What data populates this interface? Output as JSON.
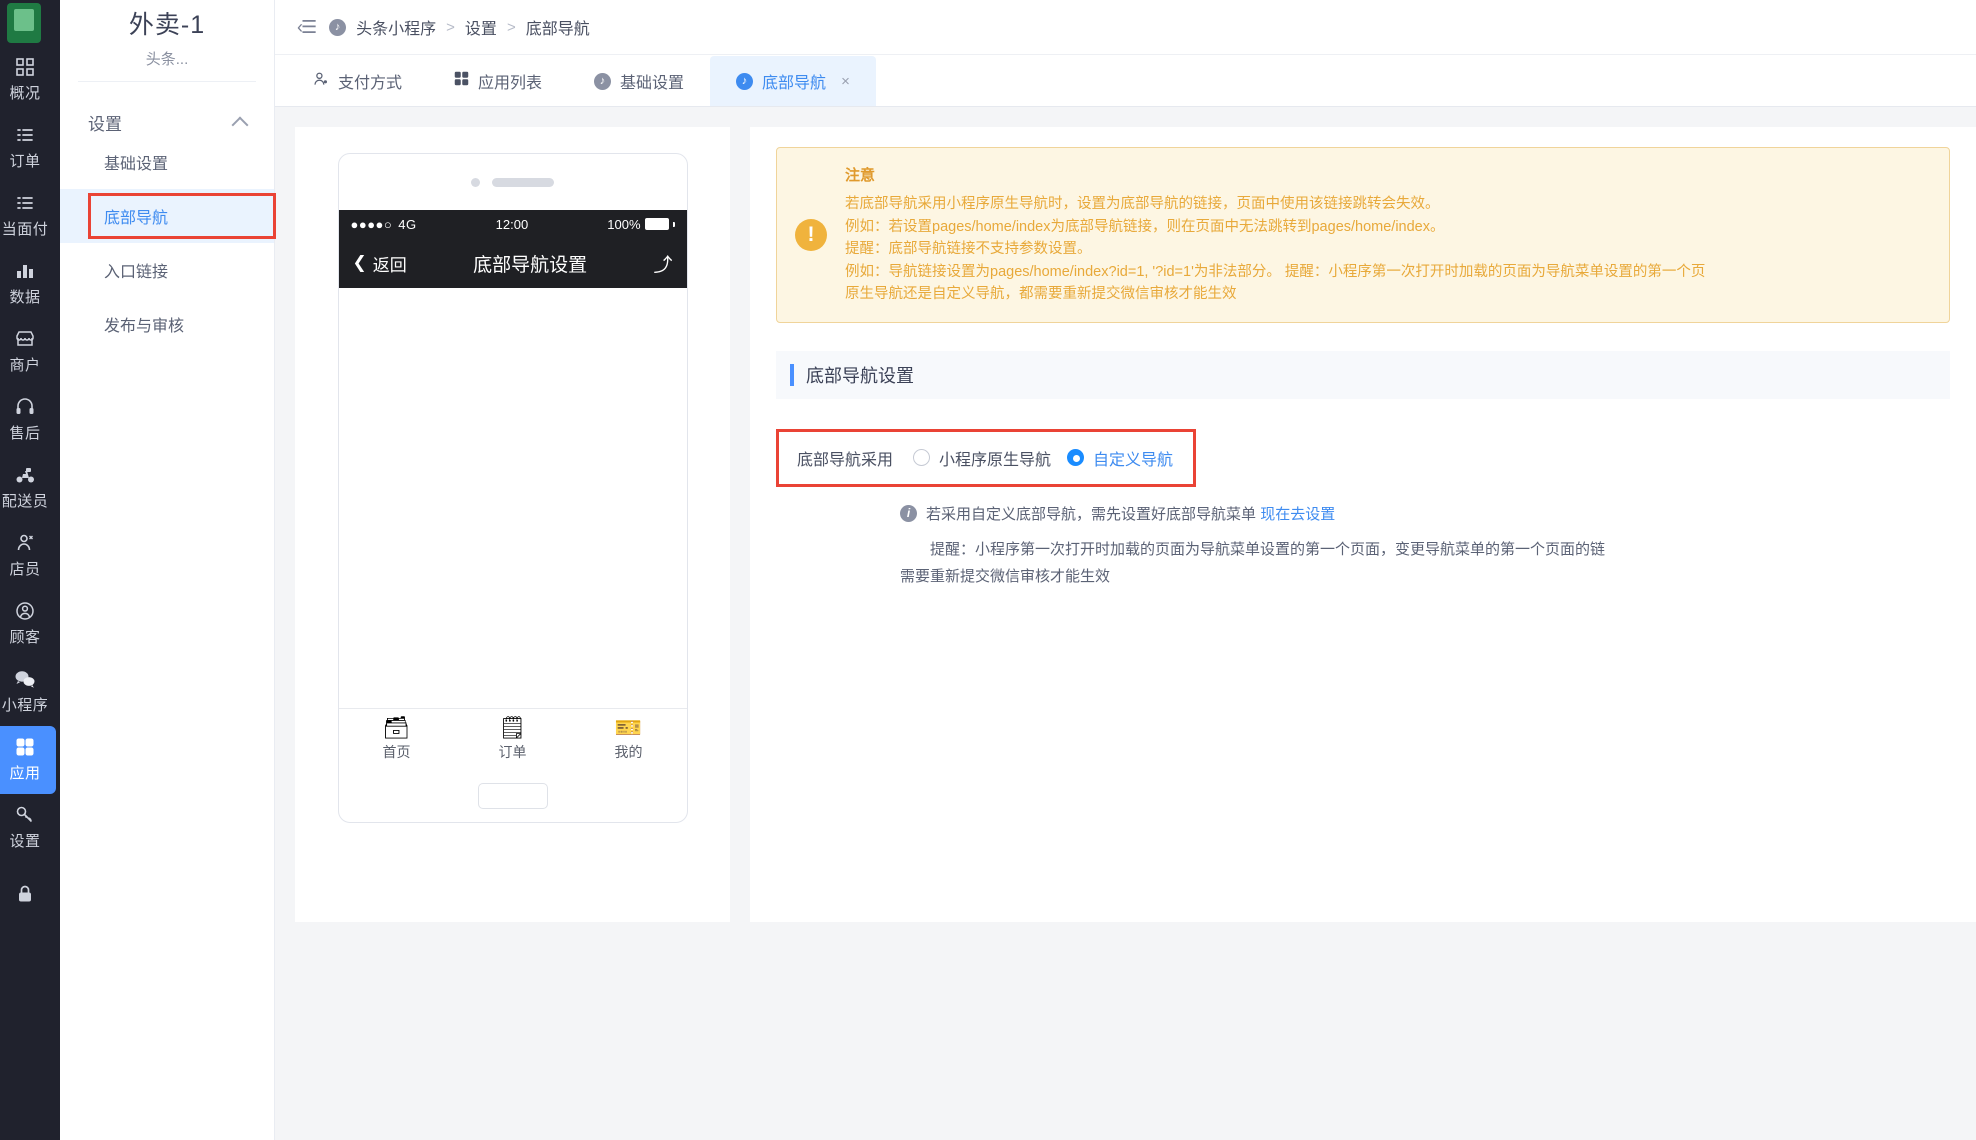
{
  "rail": {
    "logo": "app-logo",
    "items": [
      {
        "label": "概况",
        "icon": "grid-overview-icon",
        "active": false
      },
      {
        "label": "订单",
        "icon": "list-orders-icon",
        "active": false
      },
      {
        "label": "当面付",
        "icon": "list-pay-icon",
        "active": false
      },
      {
        "label": "数据",
        "icon": "bar-chart-icon",
        "active": false
      },
      {
        "label": "商户",
        "icon": "shop-icon",
        "active": false
      },
      {
        "label": "售后",
        "icon": "headset-icon",
        "active": false
      },
      {
        "label": "配送员",
        "icon": "scooter-icon",
        "active": false
      },
      {
        "label": "店员",
        "icon": "staff-icon",
        "active": false
      },
      {
        "label": "顾客",
        "icon": "customer-icon",
        "active": false
      },
      {
        "label": "小程序",
        "icon": "wechat-icon",
        "active": false
      },
      {
        "label": "应用",
        "icon": "apps-icon",
        "active": true
      },
      {
        "label": "设置",
        "icon": "settings-key-icon",
        "active": false
      },
      {
        "label": "",
        "icon": "lock-icon",
        "active": false
      }
    ]
  },
  "subnav": {
    "project_title": "外卖-1",
    "project_sub": "头条...",
    "group_label": "设置",
    "items": [
      {
        "label": "基础设置",
        "active": false,
        "highlight": false
      },
      {
        "label": "底部导航",
        "active": true,
        "highlight": true
      },
      {
        "label": "入口链接",
        "active": false,
        "highlight": false
      },
      {
        "label": "发布与审核",
        "active": false,
        "highlight": false
      }
    ]
  },
  "breadcrumb": {
    "collapse_icon": "collapse-sidebar-icon",
    "items": [
      "头条小程序",
      "设置",
      "底部导航"
    ],
    "separator": ">"
  },
  "tabs": [
    {
      "label": "支付方式",
      "icon": "payment-icon",
      "active": false,
      "closable": false
    },
    {
      "label": "应用列表",
      "icon": "apps-icon",
      "active": false,
      "closable": false
    },
    {
      "label": "基础设置",
      "icon": "toutiao-icon",
      "active": false,
      "closable": false
    },
    {
      "label": "底部导航",
      "icon": "toutiao-icon",
      "active": true,
      "closable": true,
      "close": "×"
    }
  ],
  "preview": {
    "status_bar": {
      "signal": "●●●●○",
      "network": "4G",
      "time": "12:00",
      "battery": "100%"
    },
    "header": {
      "back": "返回",
      "title": "底部导航设置",
      "share_icon": "share-icon"
    },
    "tabbar": [
      {
        "label": "首页",
        "icon": "home-nav-icon"
      },
      {
        "label": "订单",
        "icon": "order-nav-icon"
      },
      {
        "label": "我的",
        "icon": "profile-nav-icon"
      }
    ]
  },
  "notice": {
    "title": "注意",
    "lines": [
      "若底部导航采用小程序原生导航时，设置为底部导航的链接，页面中使用该链接跳转会失效。",
      "例如：若设置pages/home/index为底部导航链接，则在页面中无法跳转到pages/home/index。",
      "提醒：底部导航链接不支持参数设置。",
      "例如：导航链接设置为pages/home/index?id=1, '?id=1'为非法部分。 提醒：小程序第一次打开时加载的页面为导航菜单设置的第一个页",
      "原生导航还是自定义导航，都需要重新提交微信审核才能生效"
    ]
  },
  "section": {
    "title": "底部导航设置"
  },
  "radio_group": {
    "label": "底部导航采用",
    "options": [
      {
        "label": "小程序原生导航",
        "checked": false
      },
      {
        "label": "自定义导航",
        "checked": true
      }
    ]
  },
  "hints": {
    "info_icon": "info-icon",
    "line1_text": "若采用自定义底部导航，需先设置好底部导航菜单",
    "line1_link": "现在去设置",
    "line2a": "提醒：小程序第一次打开时加载的页面为导航菜单设置的第一个页面，变更导航菜单的第一个页面的链",
    "line2b": "需要重新提交微信审核才能生效"
  },
  "colors": {
    "accent": "#4a90ff",
    "link": "#3e8bf0",
    "highlight_box": "#ea4335",
    "notice_bg": "#fdf6e3",
    "notice_fg": "#e8a93a",
    "rail_bg": "#20222d"
  }
}
